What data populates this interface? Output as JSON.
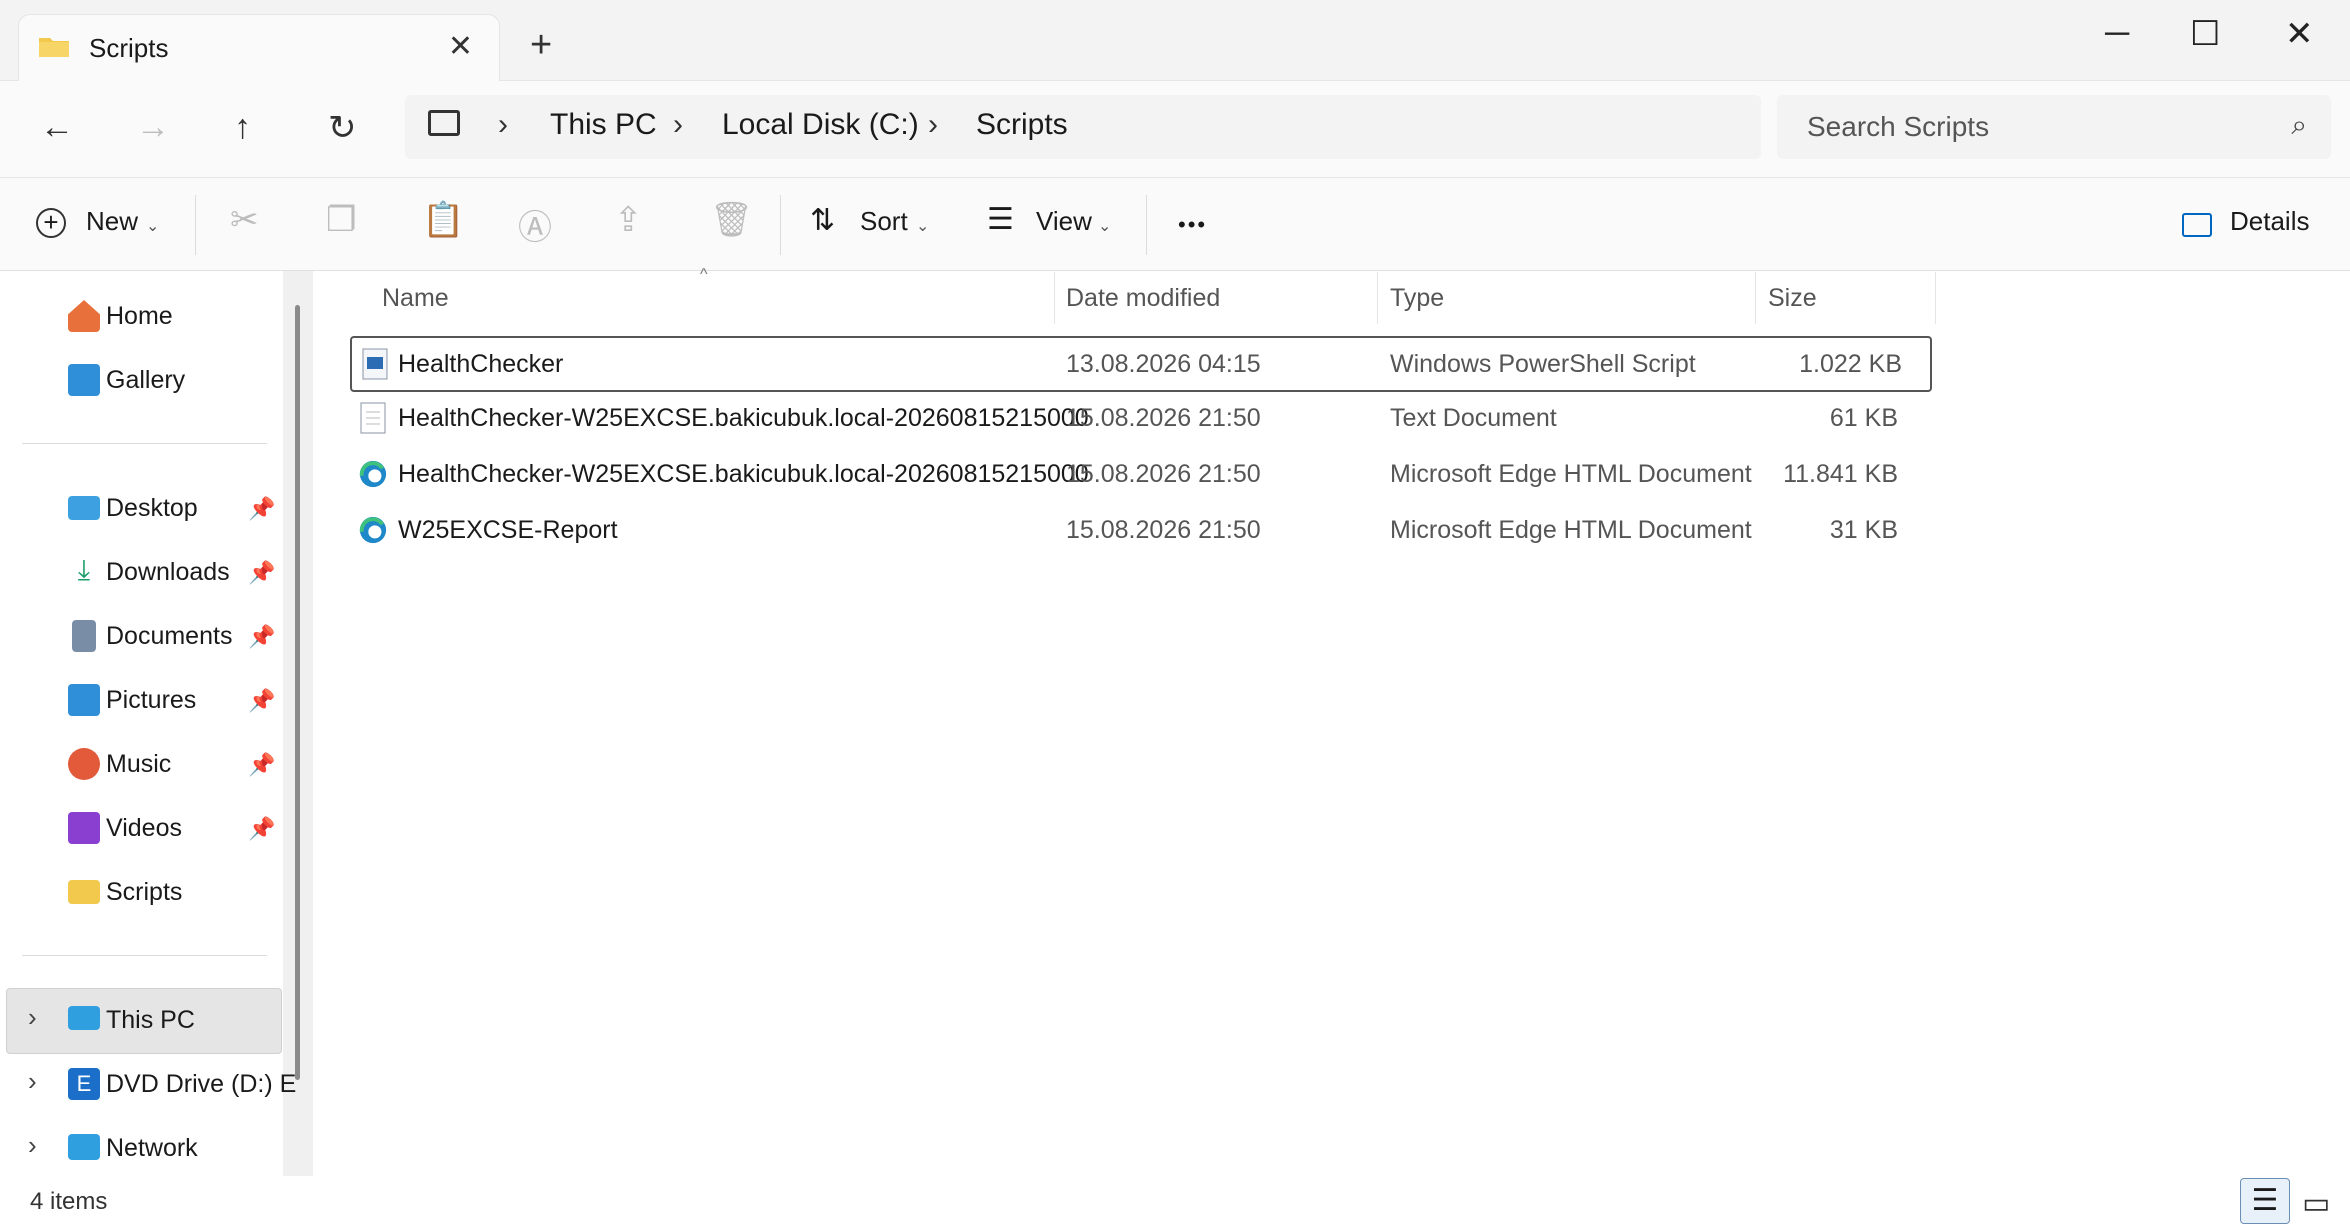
{
  "tab": {
    "title": "Scripts",
    "close_icon": "close-icon",
    "new_tab_icon": "plus-icon"
  },
  "window": {
    "minimize": "─",
    "maximize": "☐",
    "close": "✕"
  },
  "nav": {
    "back": "←",
    "forward": "→",
    "up": "↑",
    "refresh": "↻"
  },
  "breadcrumb": [
    "This PC",
    "Local Disk (C:)",
    "Scripts"
  ],
  "search": {
    "placeholder": "Search Scripts"
  },
  "toolbar": {
    "new_label": "New",
    "sort_label": "Sort",
    "view_label": "View",
    "more_label": "•••",
    "details_label": "Details"
  },
  "sidebar": {
    "home": "Home",
    "gallery": "Gallery",
    "quick": [
      "Desktop",
      "Downloads",
      "Documents",
      "Pictures",
      "Music",
      "Videos",
      "Scripts"
    ],
    "this_pc": "This PC",
    "dvd": "DVD Drive (D:) E",
    "network": "Network"
  },
  "columns": {
    "name": "Name",
    "date": "Date modified",
    "type": "Type",
    "size": "Size"
  },
  "files": [
    {
      "name": "HealthChecker",
      "date": "13.08.2026 04:15",
      "type": "Windows PowerShell Script",
      "size": "1.022 KB",
      "icon": "powershell-script-icon"
    },
    {
      "name": "HealthChecker-W25EXCSE.bakicubuk.local-20260815215000",
      "date": "15.08.2026 21:50",
      "type": "Text Document",
      "size": "61 KB",
      "icon": "text-document-icon"
    },
    {
      "name": "HealthChecker-W25EXCSE.bakicubuk.local-20260815215000",
      "date": "15.08.2026 21:50",
      "type": "Microsoft Edge HTML Document",
      "size": "11.841 KB",
      "icon": "edge-icon"
    },
    {
      "name": "W25EXCSE-Report",
      "date": "15.08.2026 21:50",
      "type": "Microsoft Edge HTML Document",
      "size": "31 KB",
      "icon": "edge-icon"
    }
  ],
  "status": {
    "items": "4 items"
  },
  "colors": {
    "accent": "#0067c0",
    "folder": "#f2c94c",
    "selection_border": "#555555"
  }
}
